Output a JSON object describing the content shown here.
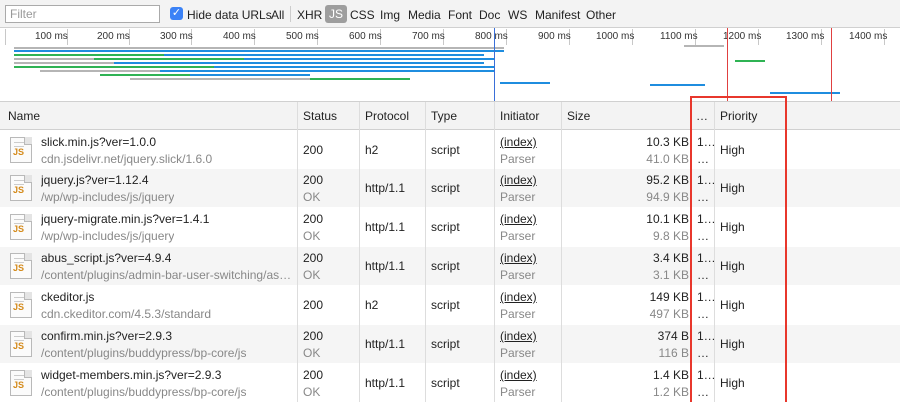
{
  "toolbar": {
    "filter_placeholder": "Filter",
    "hide_data_urls_label": "Hide data URLs",
    "all_label": "All",
    "types": [
      "XHR",
      "JS",
      "CSS",
      "Img",
      "Media",
      "Font",
      "Doc",
      "WS",
      "Manifest",
      "Other"
    ],
    "active_type": "JS"
  },
  "timeline": {
    "ticks": [
      "100 ms",
      "200 ms",
      "300 ms",
      "400 ms",
      "500 ms",
      "600 ms",
      "700 ms",
      "800 ms",
      "900 ms",
      "1000 ms",
      "1100 ms",
      "1200 ms",
      "1300 ms",
      "1400 ms"
    ]
  },
  "columns": {
    "name": "Name",
    "status": "Status",
    "protocol": "Protocol",
    "type": "Type",
    "initiator": "Initiator",
    "size": "Size",
    "time": "…",
    "priority": "Priority"
  },
  "rows": [
    {
      "name": "slick.min.js?ver=1.0.0",
      "path": "cdn.jsdelivr.net/jquery.slick/1.6.0",
      "status": "200",
      "status_text": "",
      "protocol": "h2",
      "type": "script",
      "initiator": "(index)",
      "initiator_type": "Parser",
      "size": "10.3 KB",
      "resource_size": "41.0 KB",
      "time1": "1…",
      "time2": "…",
      "priority": "High"
    },
    {
      "name": "jquery.js?ver=1.12.4",
      "path": "/wp/wp-includes/js/jquery",
      "status": "200",
      "status_text": "OK",
      "protocol": "http/1.1",
      "type": "script",
      "initiator": "(index)",
      "initiator_type": "Parser",
      "size": "95.2 KB",
      "resource_size": "94.9 KB",
      "time1": "1…",
      "time2": "…",
      "priority": "High"
    },
    {
      "name": "jquery-migrate.min.js?ver=1.4.1",
      "path": "/wp/wp-includes/js/jquery",
      "status": "200",
      "status_text": "OK",
      "protocol": "http/1.1",
      "type": "script",
      "initiator": "(index)",
      "initiator_type": "Parser",
      "size": "10.1 KB",
      "resource_size": "9.8 KB",
      "time1": "1…",
      "time2": "…",
      "priority": "High"
    },
    {
      "name": "abus_script.js?ver=4.9.4",
      "path": "/content/plugins/admin-bar-user-switching/assets…",
      "status": "200",
      "status_text": "OK",
      "protocol": "http/1.1",
      "type": "script",
      "initiator": "(index)",
      "initiator_type": "Parser",
      "size": "3.4 KB",
      "resource_size": "3.1 KB",
      "time1": "1…",
      "time2": "…",
      "priority": "High"
    },
    {
      "name": "ckeditor.js",
      "path": "cdn.ckeditor.com/4.5.3/standard",
      "status": "200",
      "status_text": "",
      "protocol": "h2",
      "type": "script",
      "initiator": "(index)",
      "initiator_type": "Parser",
      "size": "149 KB",
      "resource_size": "497 KB",
      "time1": "1…",
      "time2": "…",
      "priority": "High"
    },
    {
      "name": "confirm.min.js?ver=2.9.3",
      "path": "/content/plugins/buddypress/bp-core/js",
      "status": "200",
      "status_text": "OK",
      "protocol": "http/1.1",
      "type": "script",
      "initiator": "(index)",
      "initiator_type": "Parser",
      "size": "374 B",
      "resource_size": "116 B",
      "time1": "1…",
      "time2": "…",
      "priority": "High"
    },
    {
      "name": "widget-members.min.js?ver=2.9.3",
      "path": "/content/plugins/buddypress/bp-core/js",
      "status": "200",
      "status_text": "OK",
      "protocol": "http/1.1",
      "type": "script",
      "initiator": "(index)",
      "initiator_type": "Parser",
      "size": "1.4 KB",
      "resource_size": "1.2 KB",
      "time1": "1…",
      "time2": "…",
      "priority": "High"
    }
  ],
  "colors": {
    "js_bar": "#1f8ddf",
    "wait_bar": "#2fb354",
    "queue_bar": "#b5b5b5",
    "highlight": "#e8372c",
    "dom_line": "#3a6fd8",
    "load_line": "#e04040"
  },
  "icons": {
    "file_icon": "js-file-icon",
    "checkbox": "checkmark-icon"
  }
}
